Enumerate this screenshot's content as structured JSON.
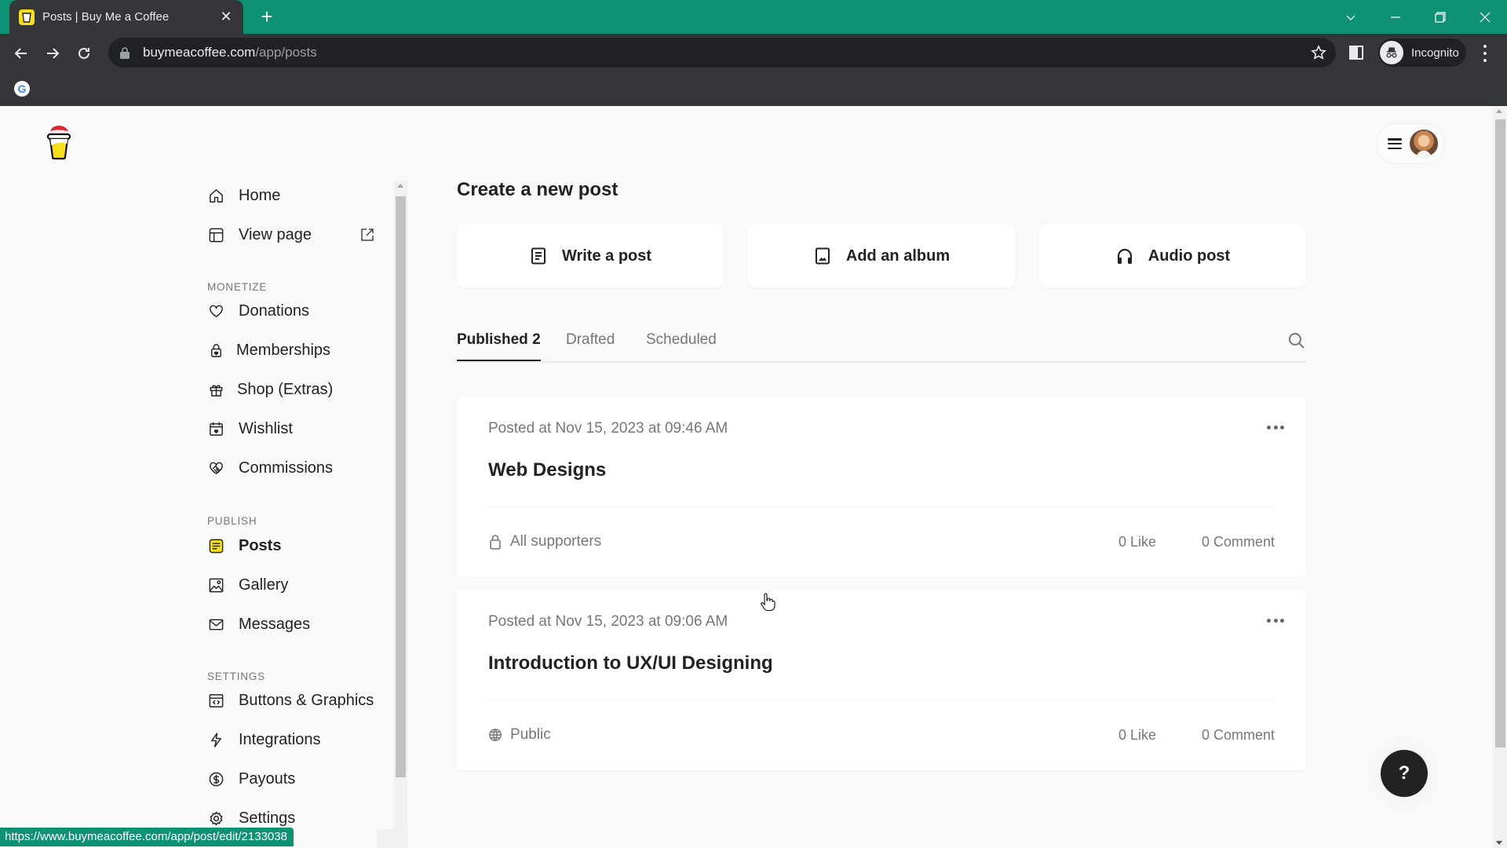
{
  "browser": {
    "tab_title": "Posts | Buy Me a Coffee",
    "url_host": "buymeacoffee.com",
    "url_path": "/app/posts",
    "profile_label": "Incognito",
    "status_url": "https://www.buymeacoffee.com/app/post/edit/2133038",
    "theme_color": "#0f9274"
  },
  "header": {
    "menu_icon": "hamburger-icon",
    "avatar": "user-avatar"
  },
  "sidebar": {
    "top_items": [
      {
        "label": "Home",
        "icon": "home-icon"
      },
      {
        "label": "View page",
        "icon": "layout-icon",
        "trailing_icon": "external-link-icon"
      }
    ],
    "sections": [
      {
        "title": "MONETIZE",
        "items": [
          {
            "label": "Donations",
            "icon": "heart-icon"
          },
          {
            "label": "Memberships",
            "icon": "lock-heart-icon"
          },
          {
            "label": "Shop (Extras)",
            "icon": "gift-icon"
          },
          {
            "label": "Wishlist",
            "icon": "calendar-heart-icon"
          },
          {
            "label": "Commissions",
            "icon": "handshake-icon"
          }
        ]
      },
      {
        "title": "PUBLISH",
        "items": [
          {
            "label": "Posts",
            "icon": "posts-icon",
            "active": true
          },
          {
            "label": "Gallery",
            "icon": "image-icon"
          },
          {
            "label": "Messages",
            "icon": "mail-icon"
          }
        ]
      },
      {
        "title": "SETTINGS",
        "items": [
          {
            "label": "Buttons & Graphics",
            "icon": "code-window-icon"
          },
          {
            "label": "Integrations",
            "icon": "lightning-icon"
          },
          {
            "label": "Payouts",
            "icon": "dollar-icon"
          },
          {
            "label": "Settings",
            "icon": "gear-icon"
          }
        ]
      }
    ]
  },
  "main": {
    "title": "Create a new post",
    "create_options": [
      {
        "label": "Write a post",
        "icon": "document-icon"
      },
      {
        "label": "Add an album",
        "icon": "image-icon"
      },
      {
        "label": "Audio post",
        "icon": "headphones-icon"
      }
    ],
    "tabs": [
      {
        "label": "Published 2",
        "active": true
      },
      {
        "label": "Drafted",
        "active": false
      },
      {
        "label": "Scheduled",
        "active": false
      }
    ],
    "posts": [
      {
        "date": "Posted at Nov 15, 2023 at 09:46 AM",
        "title": "Web Designs",
        "audience": "All supporters",
        "audience_icon": "lock-icon",
        "likes": "0 Like",
        "comments": "0 Comment"
      },
      {
        "date": "Posted at Nov 15, 2023 at 09:06 AM",
        "title": "Introduction to UX/UI Designing",
        "audience": "Public",
        "audience_icon": "globe-icon",
        "likes": "0 Like",
        "comments": "0 Comment"
      }
    ],
    "help_label": "?"
  }
}
